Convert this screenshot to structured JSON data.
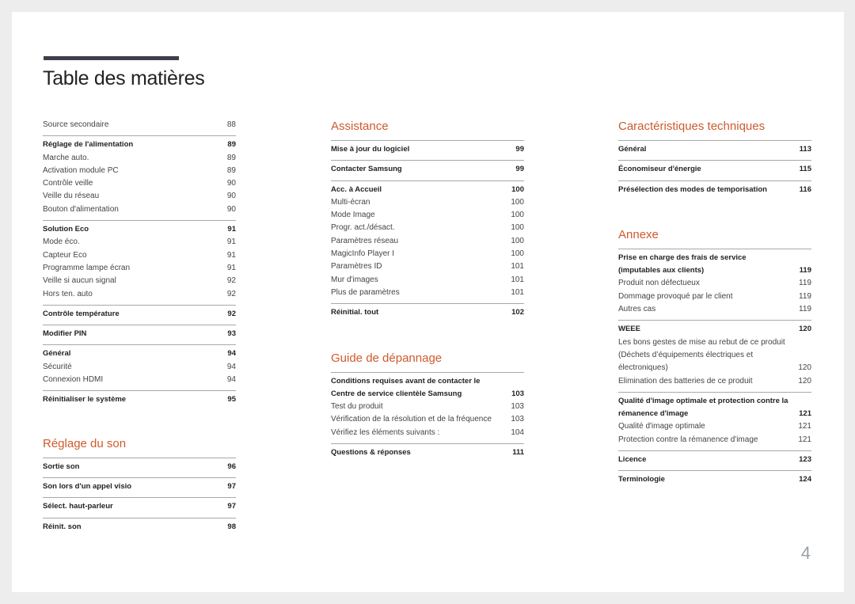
{
  "page": {
    "title": "Table des matières",
    "page_number": "4",
    "accent_color": "#cf5a2e"
  },
  "left": {
    "intro": [
      {
        "label": "Source secondaire",
        "page": "88",
        "level": "sub"
      }
    ],
    "groups": [
      {
        "items": [
          {
            "label": "Réglage de l'alimentation",
            "page": "89",
            "level": "main"
          },
          {
            "label": "Marche auto.",
            "page": "89",
            "level": "sub"
          },
          {
            "label": "Activation module PC",
            "page": "89",
            "level": "sub"
          },
          {
            "label": "Contrôle veille",
            "page": "90",
            "level": "sub"
          },
          {
            "label": "Veille du réseau",
            "page": "90",
            "level": "sub"
          },
          {
            "label": "Bouton d'alimentation",
            "page": "90",
            "level": "sub"
          }
        ]
      },
      {
        "items": [
          {
            "label": "Solution Eco",
            "page": "91",
            "level": "main"
          },
          {
            "label": "Mode éco.",
            "page": "91",
            "level": "sub"
          },
          {
            "label": "Capteur Eco",
            "page": "91",
            "level": "sub"
          },
          {
            "label": "Programme lampe écran",
            "page": "91",
            "level": "sub"
          },
          {
            "label": "Veille si aucun signal",
            "page": "92",
            "level": "sub"
          },
          {
            "label": "Hors ten. auto",
            "page": "92",
            "level": "sub"
          }
        ]
      },
      {
        "items": [
          {
            "label": "Contrôle température",
            "page": "92",
            "level": "main"
          }
        ]
      },
      {
        "items": [
          {
            "label": "Modifier PIN",
            "page": "93",
            "level": "main"
          }
        ]
      },
      {
        "items": [
          {
            "label": "Général",
            "page": "94",
            "level": "main"
          },
          {
            "label": "Sécurité",
            "page": "94",
            "level": "sub"
          },
          {
            "label": "Connexion HDMI",
            "page": "94",
            "level": "sub"
          }
        ]
      },
      {
        "items": [
          {
            "label": "Réinitialiser le système",
            "page": "95",
            "level": "main"
          }
        ]
      }
    ],
    "section2": {
      "heading": "Réglage du son",
      "groups": [
        {
          "items": [
            {
              "label": "Sortie son",
              "page": "96",
              "level": "main"
            }
          ]
        },
        {
          "items": [
            {
              "label": "Son lors d'un appel visio",
              "page": "97",
              "level": "main"
            }
          ]
        },
        {
          "items": [
            {
              "label": "Sélect. haut-parleur",
              "page": "97",
              "level": "main"
            }
          ]
        },
        {
          "items": [
            {
              "label": "Réinit. son",
              "page": "98",
              "level": "main"
            }
          ]
        }
      ]
    }
  },
  "middle": {
    "section1": {
      "heading": "Assistance",
      "groups": [
        {
          "items": [
            {
              "label": "Mise à jour du logiciel",
              "page": "99",
              "level": "main"
            }
          ]
        },
        {
          "items": [
            {
              "label": "Contacter Samsung",
              "page": "99",
              "level": "main"
            }
          ]
        },
        {
          "items": [
            {
              "label": "Acc. à Accueil",
              "page": "100",
              "level": "main"
            },
            {
              "label": "Multi-écran",
              "page": "100",
              "level": "sub"
            },
            {
              "label": "Mode Image",
              "page": "100",
              "level": "sub"
            },
            {
              "label": "Progr. act./désact.",
              "page": "100",
              "level": "sub"
            },
            {
              "label": "Paramètres réseau",
              "page": "100",
              "level": "sub"
            },
            {
              "label": "MagicInfo Player I",
              "page": "100",
              "level": "sub"
            },
            {
              "label": "Paramètres ID",
              "page": "101",
              "level": "sub"
            },
            {
              "label": "Mur d'images",
              "page": "101",
              "level": "sub"
            },
            {
              "label": "Plus de paramètres",
              "page": "101",
              "level": "sub"
            }
          ]
        },
        {
          "items": [
            {
              "label": "Réinitial. tout",
              "page": "102",
              "level": "main"
            }
          ]
        }
      ]
    },
    "section2": {
      "heading": "Guide de dépannage",
      "groups": [
        {
          "items": [
            {
              "label": "Conditions requises avant de contacter le Centre de service clientèle Samsung",
              "page": "103",
              "level": "main"
            },
            {
              "label": "Test du produit",
              "page": "103",
              "level": "sub"
            },
            {
              "label": "Vérification de la résolution et de la fréquence",
              "page": "103",
              "level": "sub"
            },
            {
              "label": "Vérifiez les éléments suivants :",
              "page": "104",
              "level": "sub"
            }
          ]
        },
        {
          "items": [
            {
              "label": "Questions & réponses",
              "page": "111",
              "level": "main"
            }
          ]
        }
      ]
    }
  },
  "right": {
    "section1": {
      "heading": "Caractéristiques techniques",
      "groups": [
        {
          "items": [
            {
              "label": "Général",
              "page": "113",
              "level": "main"
            }
          ]
        },
        {
          "items": [
            {
              "label": "Économiseur d'énergie",
              "page": "115",
              "level": "main"
            }
          ]
        },
        {
          "items": [
            {
              "label": "Présélection des modes de temporisation",
              "page": "116",
              "level": "main"
            }
          ]
        }
      ]
    },
    "section2": {
      "heading": "Annexe",
      "groups": [
        {
          "items": [
            {
              "label": "Prise en charge des frais de service (imputables aux clients)",
              "page": "119",
              "level": "main"
            },
            {
              "label": "Produit non défectueux",
              "page": "119",
              "level": "sub"
            },
            {
              "label": "Dommage provoqué par le client",
              "page": "119",
              "level": "sub"
            },
            {
              "label": "Autres cas",
              "page": "119",
              "level": "sub"
            }
          ]
        },
        {
          "items": [
            {
              "label": "WEEE",
              "page": "120",
              "level": "main"
            },
            {
              "label": "Les bons gestes de mise au rebut de ce produit (Déchets d’équipements électriques et électroniques)",
              "page": "120",
              "level": "sub"
            },
            {
              "label": "Elimination des batteries de ce produit",
              "page": "120",
              "level": "sub"
            }
          ]
        },
        {
          "items": [
            {
              "label": "Qualité d'image optimale et protection contre la rémanence d'image",
              "page": "121",
              "level": "main"
            },
            {
              "label": "Qualité d'image optimale",
              "page": "121",
              "level": "sub"
            },
            {
              "label": "Protection contre la rémanence d'image",
              "page": "121",
              "level": "sub"
            }
          ]
        },
        {
          "items": [
            {
              "label": "Licence",
              "page": "123",
              "level": "main"
            }
          ]
        },
        {
          "items": [
            {
              "label": "Terminologie",
              "page": "124",
              "level": "main"
            }
          ]
        }
      ]
    }
  }
}
